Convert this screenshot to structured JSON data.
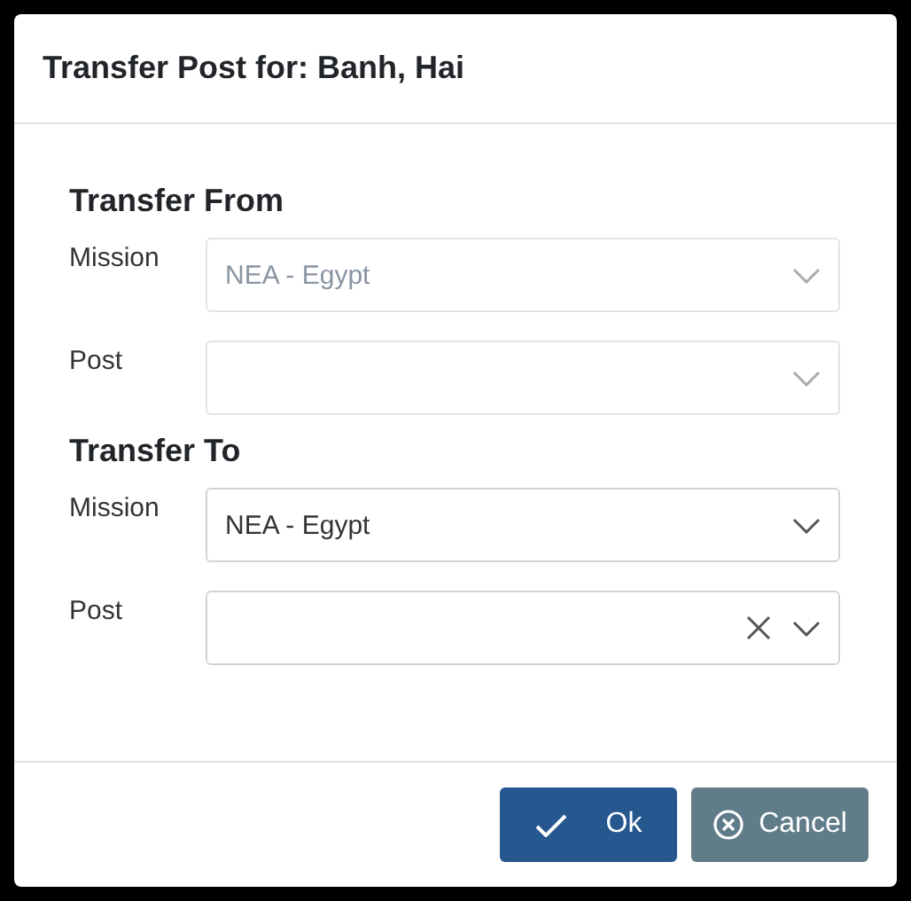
{
  "dialog": {
    "title": "Transfer Post for: Banh, Hai"
  },
  "sections": [
    {
      "heading": "Transfer From",
      "fields": [
        {
          "label": "Mission",
          "value": "NEA - Egypt",
          "disabled": true,
          "clearable": false
        },
        {
          "label": "Post",
          "disabled": true,
          "clearable": false
        }
      ]
    },
    {
      "heading": "Transfer To",
      "fields": [
        {
          "label": "Mission",
          "value": "NEA - Egypt",
          "disabled": false,
          "clearable": false
        },
        {
          "label": "Post",
          "disabled": false,
          "clearable": true
        }
      ]
    }
  ],
  "buttons": [
    {
      "label": "Ok",
      "kind": "primary"
    },
    {
      "label": "Cancel",
      "kind": "secondary"
    }
  ]
}
